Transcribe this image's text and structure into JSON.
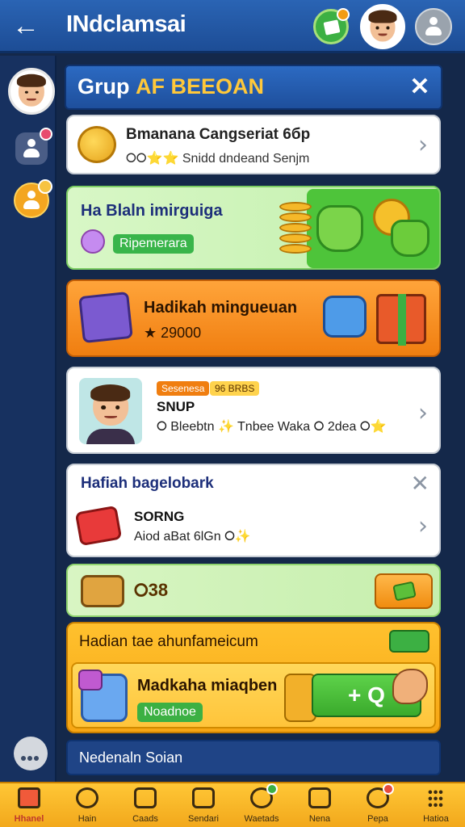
{
  "header": {
    "back_icon": "arrow-left-icon",
    "title": "INdclamsai"
  },
  "sidebar": {
    "items": [
      {
        "icon": "profile-avatar"
      },
      {
        "icon": "friend-icon"
      },
      {
        "icon": "coin-user-icon"
      },
      {
        "icon": "chat-icon"
      }
    ]
  },
  "panel": {
    "title_part1": "Grup ",
    "title_part2": "AF BEEOAN",
    "cards": {
      "c1": {
        "title": "Bmanana Cangseriat 6бр",
        "subtitle": "⭘⭘⭐⭐ Snidd dndeand Senjm"
      },
      "c2": {
        "title": "Ha Blaln imirguiga",
        "pill": "Ripemerara"
      },
      "c3": {
        "title": "Hadikah minguеuan",
        "amount": "★ 29000"
      },
      "c4": {
        "tag1": "Sesenesa",
        "tag2": "96 BRBS",
        "title": "SNUP",
        "subtitle": "⭘ Bleebtn ✨ Tnbee Waka ⭘ 2dea ⭘⭐"
      },
      "c5": {
        "header": "Hafiah bagelobark",
        "title": "SORNG",
        "subtitle": "Aiod aBat 6lGn ⭘✨"
      },
      "c6": {
        "value": "⭘38"
      },
      "c7": {
        "header": "Hadian tae ahunfameicum",
        "badge": "$",
        "title": "Madkaha miaqben",
        "pill": "Noadnoe",
        "claim_label": "+ Q"
      }
    },
    "footer_text": "Nedenaln Soian"
  },
  "bottom_nav": [
    {
      "label": "Hhanel",
      "icon": "home-icon",
      "active": true
    },
    {
      "label": "Hain",
      "icon": "heart-icon"
    },
    {
      "label": "Caads",
      "icon": "cards-icon"
    },
    {
      "label": "Sendari",
      "icon": "lock-icon"
    },
    {
      "label": "Waetads",
      "icon": "shield-icon"
    },
    {
      "label": "Nena",
      "icon": "frame-icon"
    },
    {
      "label": "Pepa",
      "icon": "badge-icon"
    },
    {
      "label": "Hatioa",
      "icon": "grid-icon"
    }
  ],
  "colors": {
    "accent": "#1d4d96",
    "nav_bar": "#f2a81c",
    "active": "#c0392b"
  }
}
